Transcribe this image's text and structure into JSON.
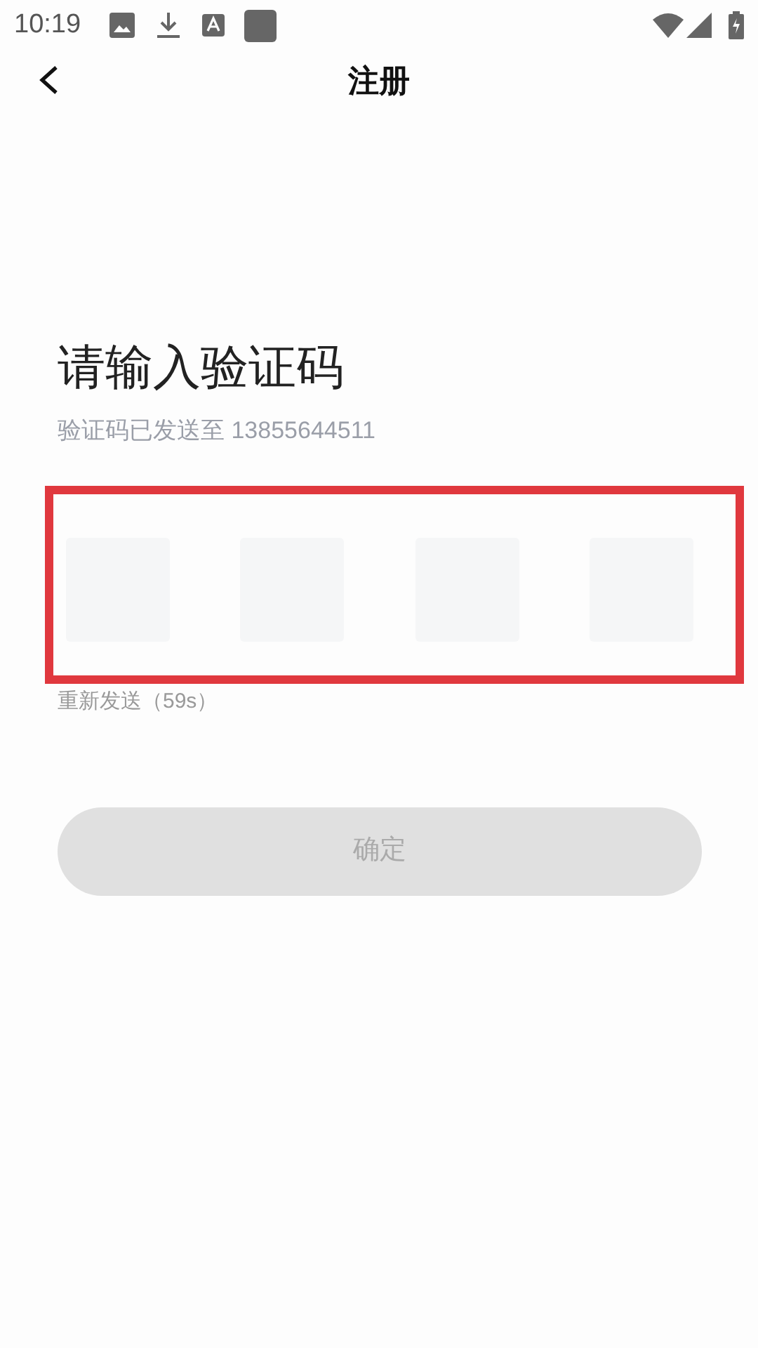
{
  "status_bar": {
    "time": "10:19"
  },
  "header": {
    "title": "注册"
  },
  "heading": "请输入验证码",
  "subtitle": "验证码已发送至 13855644511",
  "code_input": {
    "highlighted": true,
    "boxes": [
      {
        "filled": false
      },
      {
        "filled": false
      },
      {
        "filled": false
      },
      {
        "filled": false
      }
    ]
  },
  "resend": "重新发送（59s）",
  "confirm_button": {
    "label": "确定",
    "disabled": true
  }
}
